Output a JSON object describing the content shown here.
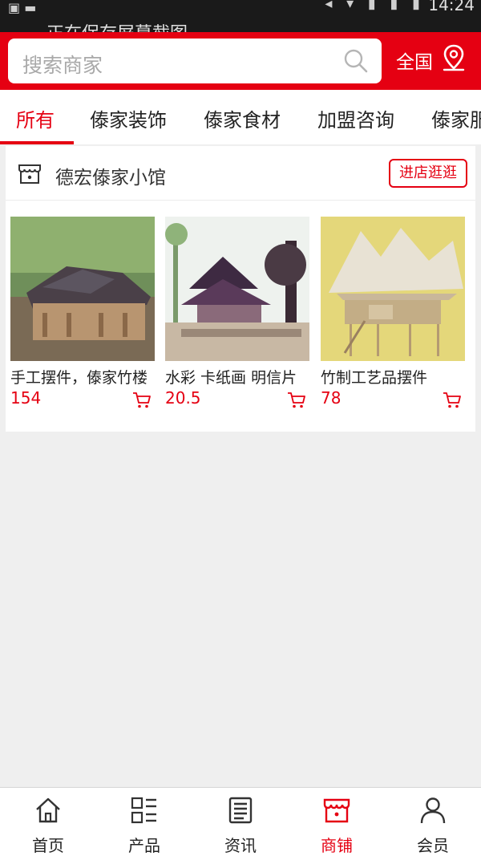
{
  "status_bar": {
    "notification": "正在保存屏幕截图",
    "time": "14:24"
  },
  "search": {
    "placeholder": "搜索商家",
    "icon": "search-icon",
    "region_label": "全国",
    "region_icon": "location-pin-icon"
  },
  "tabs": [
    {
      "label": "所有",
      "active": true
    },
    {
      "label": "傣家装饰",
      "active": false
    },
    {
      "label": "傣家食材",
      "active": false
    },
    {
      "label": "加盟咨询",
      "active": false
    },
    {
      "label": "傣家服",
      "active": false
    }
  ],
  "shop": {
    "name": "德宏傣家小馆",
    "icon": "store-icon",
    "visit_label": "进店逛逛",
    "products": [
      {
        "name": "手工摆件，傣家竹楼",
        "price": "154",
        "image": "wooden-house-model-photo"
      },
      {
        "name": "水彩 卡纸画 明信片",
        "price": "20.5",
        "image": "watercolor-painting-photo"
      },
      {
        "name": "竹制工艺品摆件",
        "price": "78",
        "image": "bamboo-stilt-house-photo"
      }
    ]
  },
  "bottom_nav": [
    {
      "label": "首页",
      "icon": "home-icon",
      "active": false
    },
    {
      "label": "产品",
      "icon": "grid-list-icon",
      "active": false
    },
    {
      "label": "资讯",
      "icon": "news-icon",
      "active": false
    },
    {
      "label": "商铺",
      "icon": "store-icon",
      "active": true
    },
    {
      "label": "会员",
      "icon": "user-icon",
      "active": false
    }
  ],
  "colors": {
    "brand_red": "#e50012",
    "background": "#efefef"
  }
}
